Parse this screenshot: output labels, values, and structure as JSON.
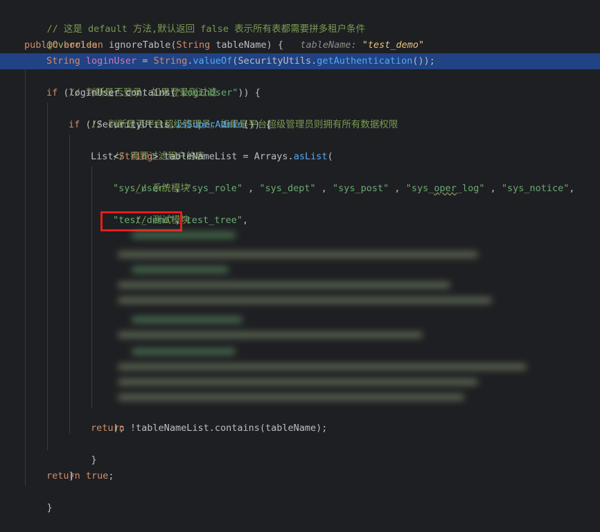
{
  "lines": {
    "l1": "// 这是 default 方法,默认返回 false 表示所有表都需要拼多租户条件",
    "l2": "@Override",
    "l3_public": "public",
    "l3_boolean": "boolean",
    "l3_method": "ignoreTable",
    "l3_paren_open": "(",
    "l3_type": "String",
    "l3_param": " tableName",
    "l3_paren_close": ")",
    "l3_brace": " {",
    "l3_hint_name": "tableName: ",
    "l3_hint_value": "\"test_demo\"",
    "l4_type": "String",
    "l4_var": "loginUser",
    "l4_eq": " = ",
    "l4_cls": "String",
    "l4_dot": ".",
    "l4_valueof": "valueOf",
    "l4_paren": "(",
    "l4_su": "SecurityUtils",
    "l4_dot2": ".",
    "l4_getauth": "getAuthentication",
    "l4_end": "());",
    "l5": "// 判断是否登录，如果登录则过滤",
    "l6_if": "if",
    "l6_rest1": " (",
    "l6_var": "loginUser",
    "l6_rest2": ".contains(",
    "l6_str": "\"LoginUser\"",
    "l6_rest3": ")) {",
    "l7": "// 判断是否平台超级管理员，如果是平台超级管理员则拥有所有数据权限",
    "l8_if": "if",
    "l8_rest1": " (!SecurityUtils.",
    "l8_fn": "isSuperAdmin",
    "l8_rest2": "()) {",
    "l9": "// 需要过滤租户的表",
    "l10_list": "List",
    "l10_lt": "<",
    "l10_string": "String",
    "l10_gt": ">",
    "l10_var": " tableNameList",
    "l10_eq": " = ",
    "l10_arrays": "Arrays",
    "l10_dot": ".",
    "l10_aslist": "asList",
    "l10_paren": "(",
    "l11": "// 系统模块",
    "l12_s1": "\"sys_user\"",
    "l12_s2": "\"sys_role\"",
    "l12_s3": "\"sys_dept\"",
    "l12_s4": "\"sys_post\"",
    "l12_s5a": "\"sys_",
    "l12_s5b": "oper",
    "l12_s5c": "_log\"",
    "l12_s6": "\"sys_notice\"",
    "l12_sep": " , ",
    "l12_end": ",",
    "l13": "// 测试模块",
    "l14_s1": "\"test_demo\"",
    "l14_s2": "\"test_tree\"",
    "l14_comma": ",",
    "l15": ");",
    "l16_return": "return",
    "l16_rest1": " !",
    "l16_var": "tableNameList",
    "l16_rest2": ".contains(tableName);",
    "l17": "}",
    "l18": "}",
    "l19_return": "return",
    "l19_true": " true",
    "l19_semi": ";",
    "l20": "}"
  },
  "colors": {
    "background": "#1e1f22",
    "active_line": "#214283",
    "comment": "#7a9a52",
    "keyword": "#cf8e6d",
    "method": "#56a8f5",
    "string": "#6aab73",
    "highlight_box": "#e81c1c"
  }
}
